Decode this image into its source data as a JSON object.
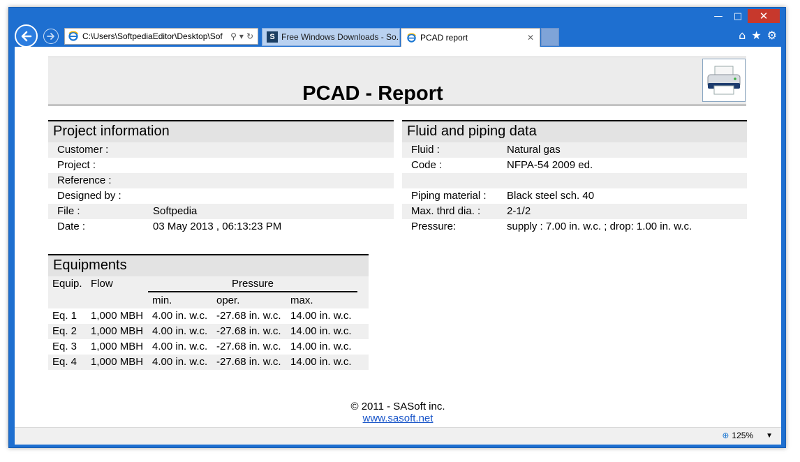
{
  "browser": {
    "address_url": "C:\\Users\\SoftpediaEditor\\Desktop\\Sof",
    "tabs": [
      {
        "label": "Free Windows Downloads - So..."
      },
      {
        "label": "PCAD report"
      }
    ],
    "zoom_label": "125%"
  },
  "report": {
    "title": "PCAD - Report",
    "project": {
      "heading": "Project information",
      "rows": [
        {
          "key": "Customer :",
          "value": ""
        },
        {
          "key": "Project :",
          "value": ""
        },
        {
          "key": "Reference :",
          "value": ""
        },
        {
          "key": "Designed by :",
          "value": ""
        },
        {
          "key": "File :",
          "value": "Softpedia"
        },
        {
          "key": "Date :",
          "value": "03 May 2013 , 06:13:23 PM"
        }
      ]
    },
    "fluid": {
      "heading": "Fluid and piping data",
      "rows": [
        {
          "key": "Fluid :",
          "value": "Natural gas"
        },
        {
          "key": "Code :",
          "value": "NFPA-54 2009 ed."
        },
        {
          "key": "",
          "value": ""
        },
        {
          "key": "Piping material :",
          "value": "Black steel sch. 40"
        },
        {
          "key": "Max. thrd dia. :",
          "value": "2-1/2"
        },
        {
          "key": "Pressure:",
          "value": "supply : 7.00 in. w.c. ; drop: 1.00 in. w.c."
        }
      ]
    },
    "equipments": {
      "heading": "Equipments",
      "col_equip": "Equip.",
      "col_flow": "Flow",
      "col_pressure": "Pressure",
      "col_min": "min.",
      "col_oper": "oper.",
      "col_max": "max.",
      "rows": [
        {
          "equip": "Eq. 1",
          "flow": "1,000 MBH",
          "min": "4.00 in. w.c.",
          "oper": "-27.68 in. w.c.",
          "max": "14.00 in. w.c."
        },
        {
          "equip": "Eq. 2",
          "flow": "1,000 MBH",
          "min": "4.00 in. w.c.",
          "oper": "-27.68 in. w.c.",
          "max": "14.00 in. w.c."
        },
        {
          "equip": "Eq. 3",
          "flow": "1,000 MBH",
          "min": "4.00 in. w.c.",
          "oper": "-27.68 in. w.c.",
          "max": "14.00 in. w.c."
        },
        {
          "equip": "Eq. 4",
          "flow": "1,000 MBH",
          "min": "4.00 in. w.c.",
          "oper": "-27.68 in. w.c.",
          "max": "14.00 in. w.c."
        }
      ]
    },
    "footer": {
      "copyright": "© 2011 - SASoft inc.",
      "link": "www.sasoft.net"
    }
  },
  "colors": {
    "window_frame": "#1e6fd0",
    "section_header": "#e3e3e3",
    "row_shade": "#efefef",
    "link": "#1a56c9"
  }
}
